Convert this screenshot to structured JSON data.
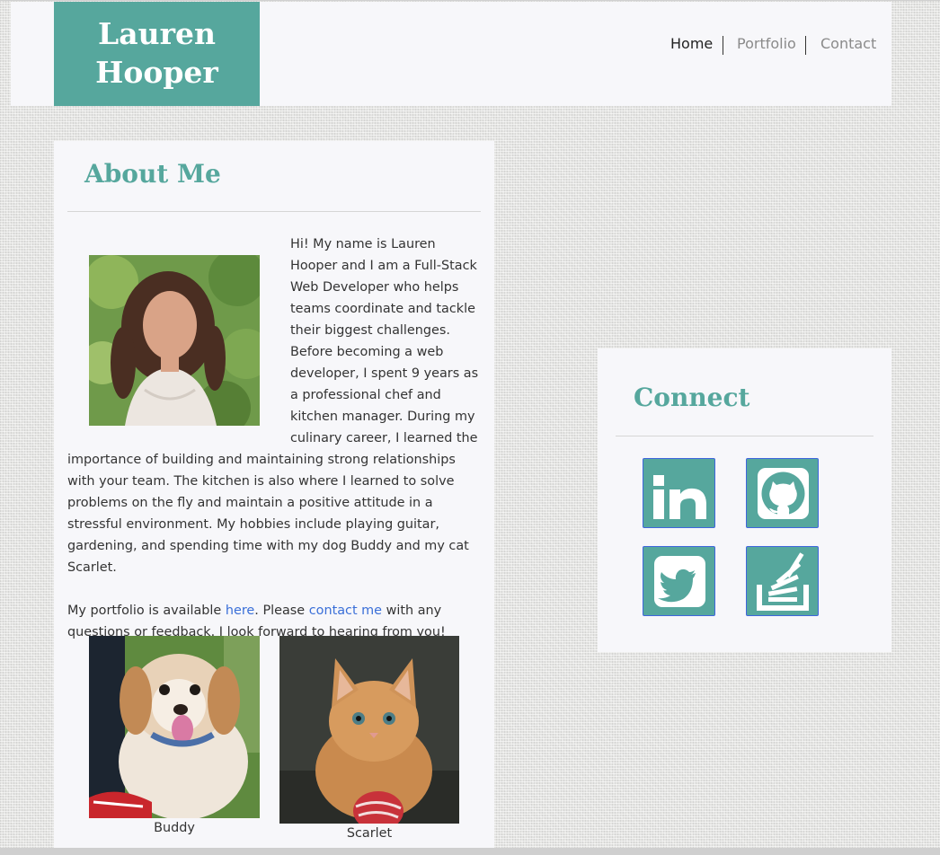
{
  "header": {
    "logo_line1": "Lauren",
    "logo_line2": "Hooper",
    "nav": [
      {
        "label": "Home",
        "active": true
      },
      {
        "label": "Portfolio",
        "active": false
      },
      {
        "label": "Contact",
        "active": false
      }
    ]
  },
  "about": {
    "title": "About Me",
    "paragraph1": "Hi! My name is Lauren Hooper and I am a Full-Stack Web Developer who helps teams coordinate and tackle their biggest challenges. Before becoming a web developer, I spent 9 years as a professional chef and kitchen manager. During my culinary career, I learned the importance of building and maintaining strong relationships with your team. The kitchen is also where I learned to solve problems on the fly and maintain a positive attitude in a stressful environment. My hobbies include playing guitar, gardening, and spending time with my dog Buddy and my cat Scarlet.",
    "p2_before": "My portfolio is available ",
    "p2_link1": "here",
    "p2_middle": ". Please ",
    "p2_link2": "contact me",
    "p2_after": " with any questions or feedback. I look forward to hearing from you!",
    "pets": [
      {
        "caption": "Buddy"
      },
      {
        "caption": "Scarlet"
      }
    ]
  },
  "connect": {
    "title": "Connect",
    "links": [
      {
        "icon": "linkedin-icon"
      },
      {
        "icon": "github-icon"
      },
      {
        "icon": "twitter-icon"
      },
      {
        "icon": "stackoverflow-icon"
      }
    ]
  },
  "colors": {
    "accent": "#56a79d",
    "link": "#3a6fd8",
    "card_bg": "#f7f7fa",
    "text": "#333333"
  }
}
